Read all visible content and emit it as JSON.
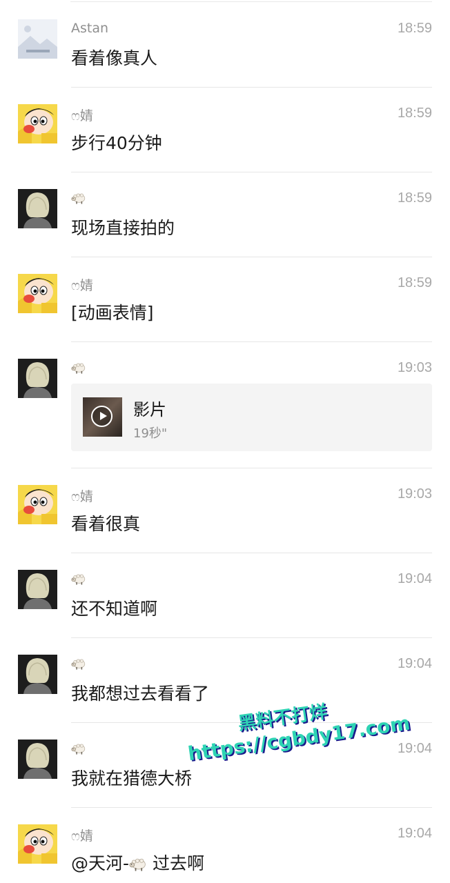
{
  "messages": [
    {
      "sender": "Astan",
      "time": "18:59",
      "text": "看着像真人",
      "avatar": "landscape-placeholder-icon"
    },
    {
      "sender": "ෆ婧",
      "time": "18:59",
      "text": "步行40分钟",
      "avatar": "cartoon-boy-avatar"
    },
    {
      "sender": "🐑",
      "time": "18:59",
      "text": "现场直接拍的",
      "avatar": "blonde-hair-avatar"
    },
    {
      "sender": "ෆ婧",
      "time": "18:59",
      "text": "[动画表情]",
      "avatar": "cartoon-boy-avatar"
    },
    {
      "sender": "🐑",
      "time": "19:03",
      "video": {
        "title": "影片",
        "duration": "19秒\""
      },
      "avatar": "blonde-hair-avatar"
    },
    {
      "sender": "ෆ婧",
      "time": "19:03",
      "text": "看着很真",
      "avatar": "cartoon-boy-avatar"
    },
    {
      "sender": "🐑",
      "time": "19:04",
      "text": "还不知道啊",
      "avatar": "blonde-hair-avatar"
    },
    {
      "sender": "🐑",
      "time": "19:04",
      "text": "我都想过去看看了",
      "avatar": "blonde-hair-avatar"
    },
    {
      "sender": "🐑",
      "time": "19:04",
      "text": "我就在猎德大桥",
      "avatar": "blonde-hair-avatar"
    },
    {
      "sender": "ෆ婧",
      "time": "19:04",
      "text_prefix": "@天河-",
      "text_suffix": " 过去啊",
      "avatar": "cartoon-boy-avatar"
    }
  ],
  "watermark": {
    "line1": "黑料不打烊",
    "line2": "https://cgbdy17.com"
  },
  "colors": {
    "watermark": "#2fd4b4",
    "watermark_shadow": "#1a1a8c",
    "time": "#a8a8a8",
    "divider": "#e6e6e6"
  }
}
